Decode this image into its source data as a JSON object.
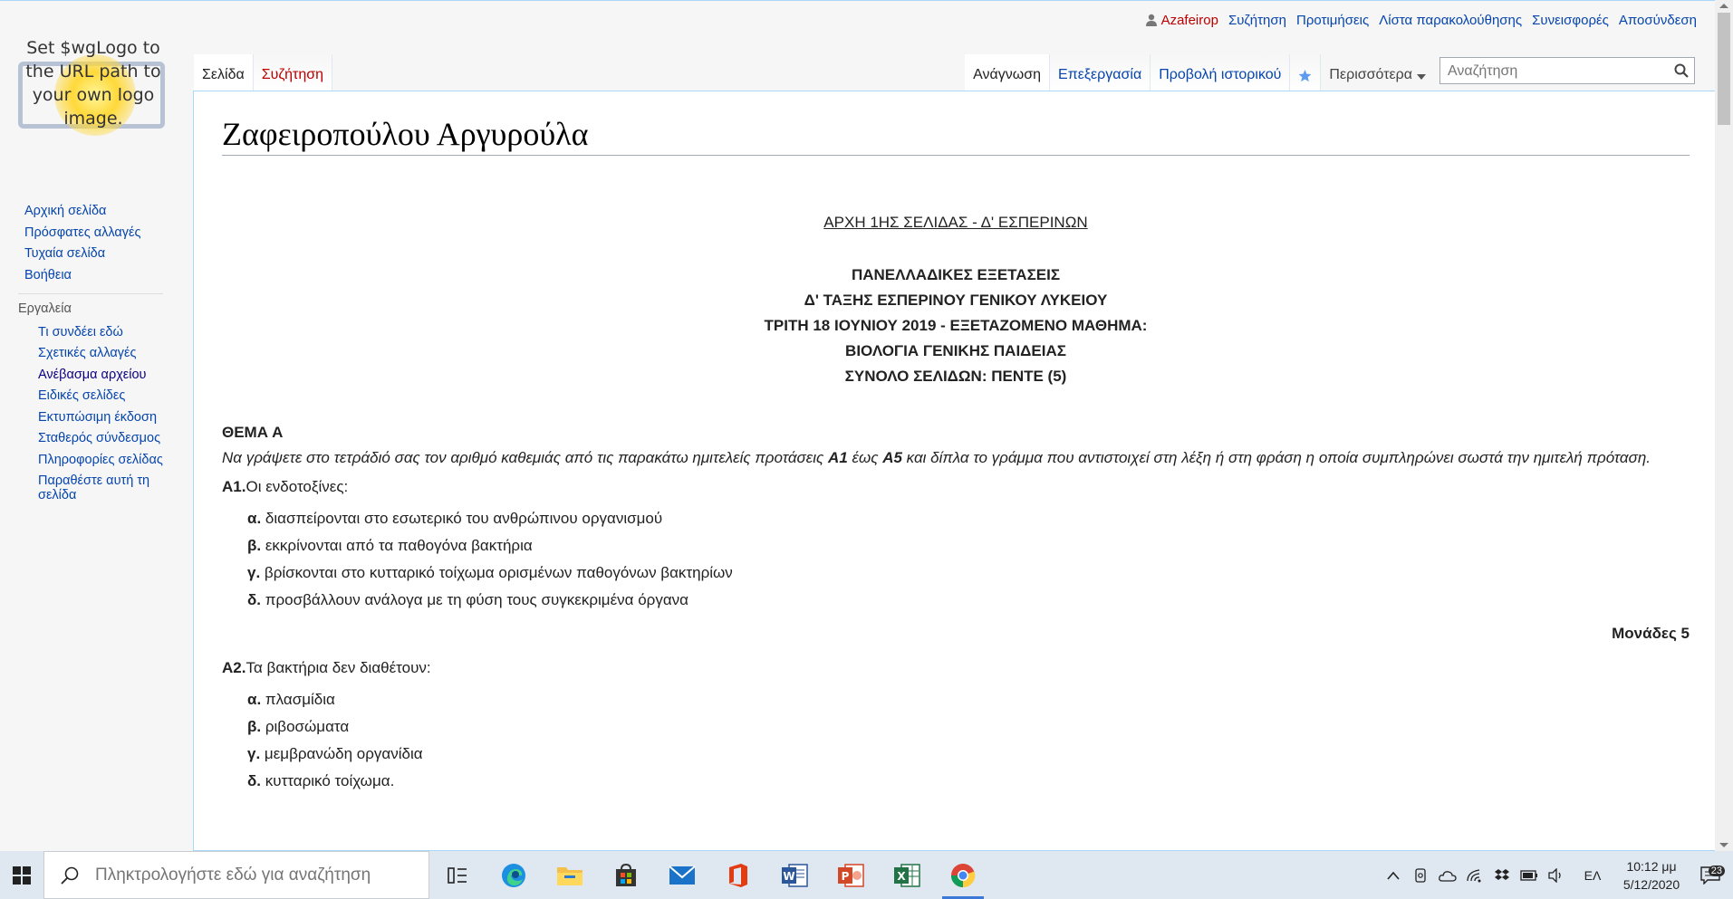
{
  "logo": {
    "text": "Set $wgLogo to the URL path to your own logo image."
  },
  "personal_tools": {
    "username": "Azafeirop",
    "items": [
      "Συζήτηση",
      "Προτιμήσεις",
      "Λίστα παρακολούθησης",
      "Συνεισφορές",
      "Αποσύνδεση"
    ]
  },
  "namespace_tabs": [
    {
      "label": "Σελίδα",
      "selected": true
    },
    {
      "label": "Συζήτηση",
      "selected": false,
      "red": true
    }
  ],
  "view_tabs": [
    {
      "label": "Ανάγνωση",
      "selected": true
    },
    {
      "label": "Επεξεργασία",
      "selected": false
    },
    {
      "label": "Προβολή ιστορικού",
      "selected": false
    }
  ],
  "more_menu": {
    "label": "Περισσότερα"
  },
  "search": {
    "placeholder": "Αναζήτηση"
  },
  "sidebar": {
    "navigation": [
      "Αρχική σελίδα",
      "Πρόσφατες αλλαγές",
      "Τυχαία σελίδα",
      "Βοήθεια"
    ],
    "tools_heading": "Εργαλεία",
    "tools": [
      "Τι συνδέει εδώ",
      "Σχετικές αλλαγές",
      "Ανέβασμα αρχείου",
      "Ειδικές σελίδες",
      "Εκτυπώσιμη έκδοση",
      "Σταθερός σύνδεσμος",
      "Πληροφορίες σελίδας",
      "Παραθέστε αυτή τη σελίδα"
    ]
  },
  "page": {
    "title": "Ζαφειροπούλου Αργυρούλα",
    "page_marker": "ΑΡΧΗ 1ΗΣ ΣΕΛΙΔΑΣ - Δ' ΕΣΠΕΡΙΝΩΝ",
    "header_lines": [
      "ΠΑΝΕΛΛΑΔΙΚΕΣ ΕΞΕΤΑΣΕΙΣ",
      "Δ' ΤΑΞΗΣ ΕΣΠΕΡΙΝΟΥ ΓΕΝΙΚΟΥ ΛΥΚΕΙΟΥ",
      "ΤΡΙΤΗ 18 ΙΟΥΝΙΟΥ 2019 - ΕΞΕΤΑΖΟΜΕΝΟ ΜΑΘΗΜΑ:",
      "ΒΙΟΛΟΓΙΑ ΓΕΝΙΚΗΣ ΠΑΙΔΕΙΑΣ",
      "ΣΥΝΟΛΟ ΣΕΛΙΔΩΝ: ΠΕΝΤΕ (5)"
    ],
    "section_title": "ΘΕΜΑ Α",
    "instructions": {
      "part1": "Να γράψετε στο τετράδιό σας τον αριθμό καθεμιάς από τις παρακάτω ημιτελείς προτάσεις ",
      "bold1": "Α1",
      "part2": " έως ",
      "bold2": "Α5",
      "part3": " και δίπλα το γράμμα που αντιστοιχεί στη λέξη ή στη φράση η οποία συμπληρώνει σωστά την ημιτελή πρόταση."
    },
    "questions": [
      {
        "number": "Α1.",
        "text": "Οι ενδοτοξίνες:",
        "options": [
          {
            "letter": "α.",
            "text": "διασπείρονται στο εσωτερικό του ανθρώπινου οργανισμού"
          },
          {
            "letter": "β.",
            "text": "εκκρίνονται από τα παθογόνα βακτήρια"
          },
          {
            "letter": "γ.",
            "text": "βρίσκονται στο κυτταρικό τοίχωμα ορισμένων παθογόνων βακτηρίων"
          },
          {
            "letter": "δ.",
            "text": "προσβάλλουν ανάλογα με τη φύση τους συγκεκριμένα όργανα"
          }
        ],
        "points": "Μονάδες 5"
      },
      {
        "number": "Α2.",
        "text": "Τα βακτήρια δεν διαθέτουν:",
        "options": [
          {
            "letter": "α.",
            "text": "πλασμίδια"
          },
          {
            "letter": "β.",
            "text": "ριβοσώματα"
          },
          {
            "letter": "γ.",
            "text": "μεμβρανώδη οργανίδια"
          },
          {
            "letter": "δ.",
            "text": "κυτταρικό τοίχωμα."
          }
        ]
      }
    ]
  },
  "taskbar": {
    "search_placeholder": "Πληκτρολογήστε εδώ για αναζήτηση",
    "apps": [
      "task-view",
      "edge",
      "file-explorer",
      "store",
      "mail",
      "office",
      "word",
      "powerpoint",
      "excel",
      "chrome"
    ],
    "active_app": "chrome",
    "language": "ΕΛ",
    "time": "10:12 μμ",
    "date": "5/12/2020",
    "notification_count": "23"
  },
  "colors": {
    "link": "#0645ad",
    "redlink": "#ba0000",
    "tab_border": "#a7d7f9"
  }
}
